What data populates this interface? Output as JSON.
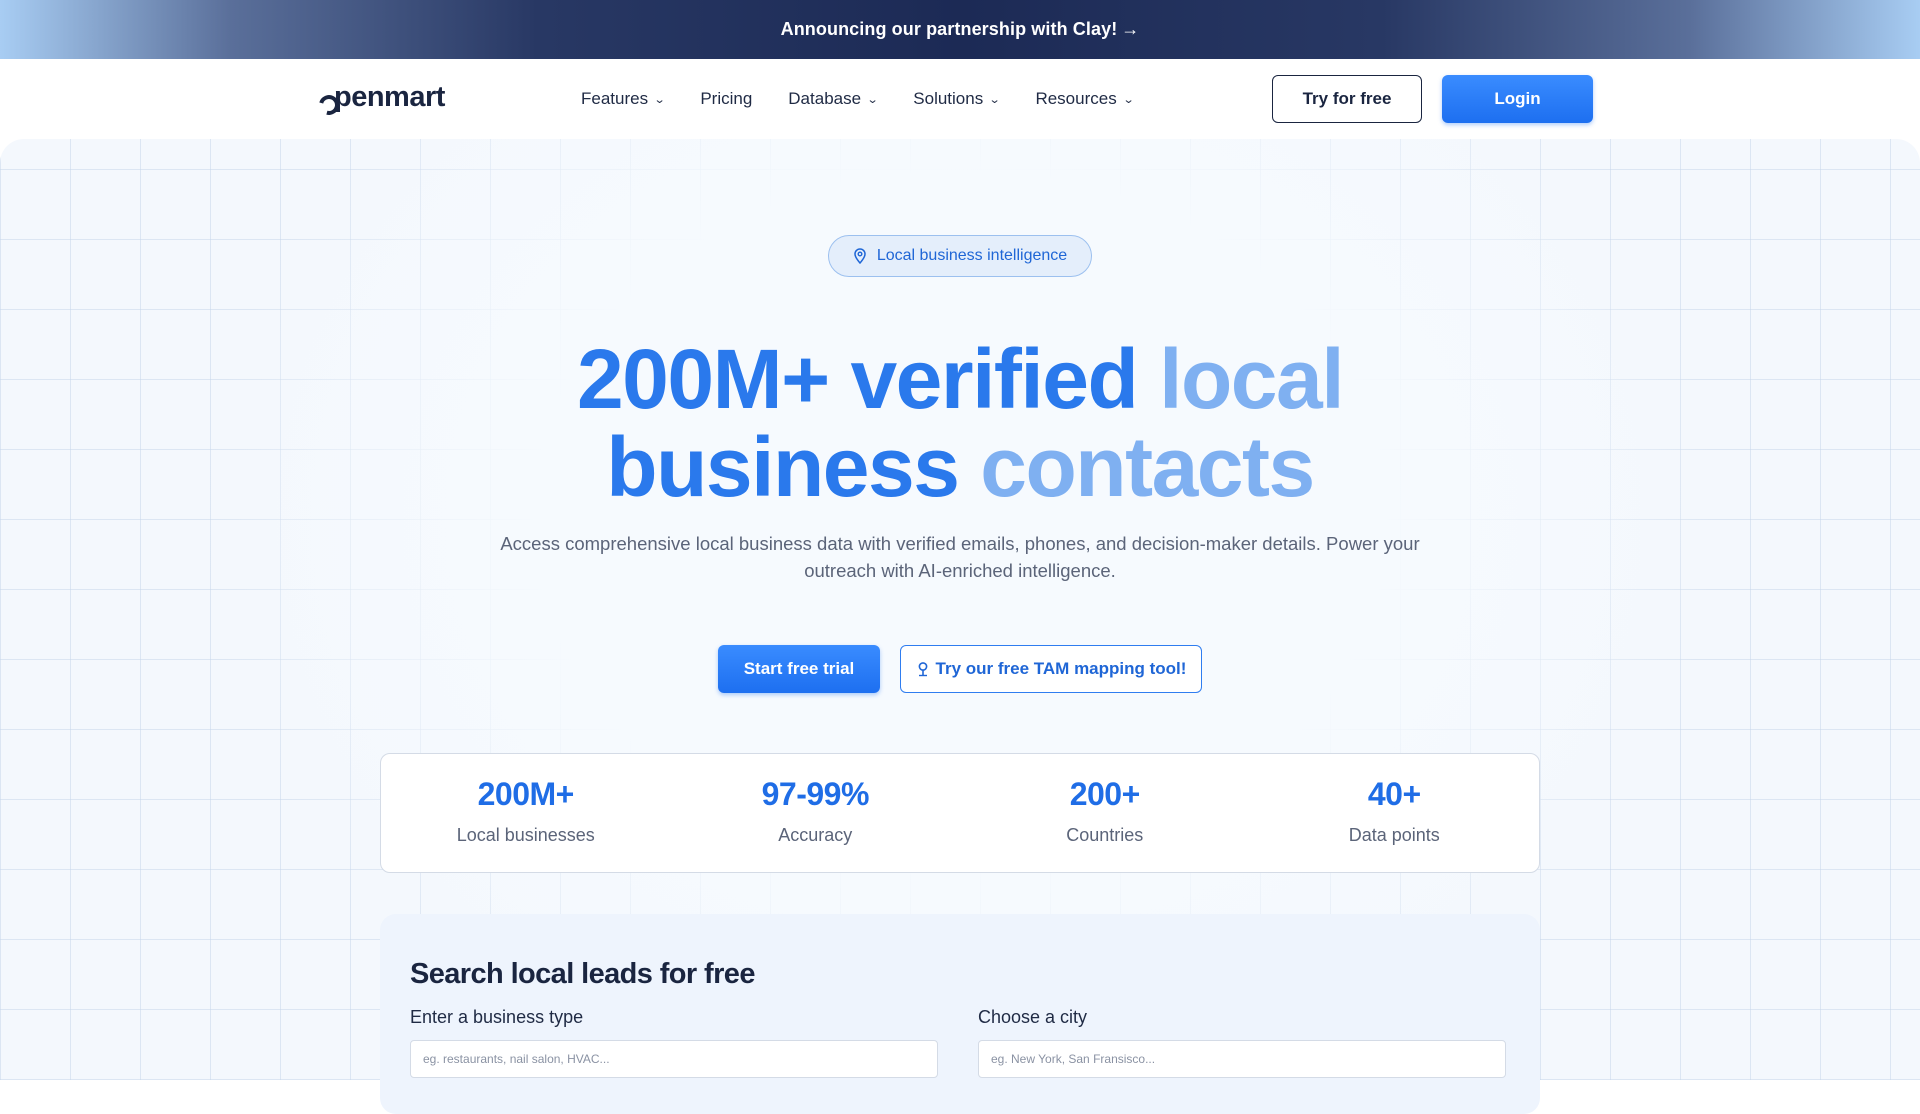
{
  "banner": {
    "text": "Announcing our partnership with Clay!",
    "arrow": "→"
  },
  "nav": {
    "logo": "penmart",
    "links": [
      {
        "label": "Features",
        "has_dropdown": true
      },
      {
        "label": "Pricing",
        "has_dropdown": false
      },
      {
        "label": "Database",
        "has_dropdown": true
      },
      {
        "label": "Solutions",
        "has_dropdown": true
      },
      {
        "label": "Resources",
        "has_dropdown": true
      }
    ],
    "try_label": "Try for free",
    "login_label": "Login"
  },
  "hero": {
    "pill_label": "Local business intelligence",
    "headline": {
      "part1": "200M+ verified",
      "part2": "local",
      "part3": "business",
      "part4": "contacts"
    },
    "subtext": "Access comprehensive local business data with verified emails, phones, and decision-maker details. Power your outreach with AI-enriched intelligence.",
    "cta_primary": "Start free trial",
    "cta_secondary": "Try our free TAM mapping tool!"
  },
  "stats": [
    {
      "value": "200M+",
      "label": "Local businesses"
    },
    {
      "value": "97-99%",
      "label": "Accuracy"
    },
    {
      "value": "200+",
      "label": "Countries"
    },
    {
      "value": "40+",
      "label": "Data points"
    }
  ],
  "search": {
    "title": "Search local leads for free",
    "business_label": "Enter a business type",
    "business_placeholder": "eg. restaurants, nail salon, HVAC...",
    "city_label": "Choose a city",
    "city_placeholder": "eg. New York, San Fransisco..."
  },
  "colors": {
    "brand_blue": "#1d6ff0",
    "headline_blue": "#2a79ec",
    "headline_light_blue": "#7fb0f1",
    "navy": "#1a2540"
  },
  "icons": {
    "pill": "location-pin-icon",
    "tam": "map-pin-icon",
    "dropdown": "chevron-down-icon"
  }
}
